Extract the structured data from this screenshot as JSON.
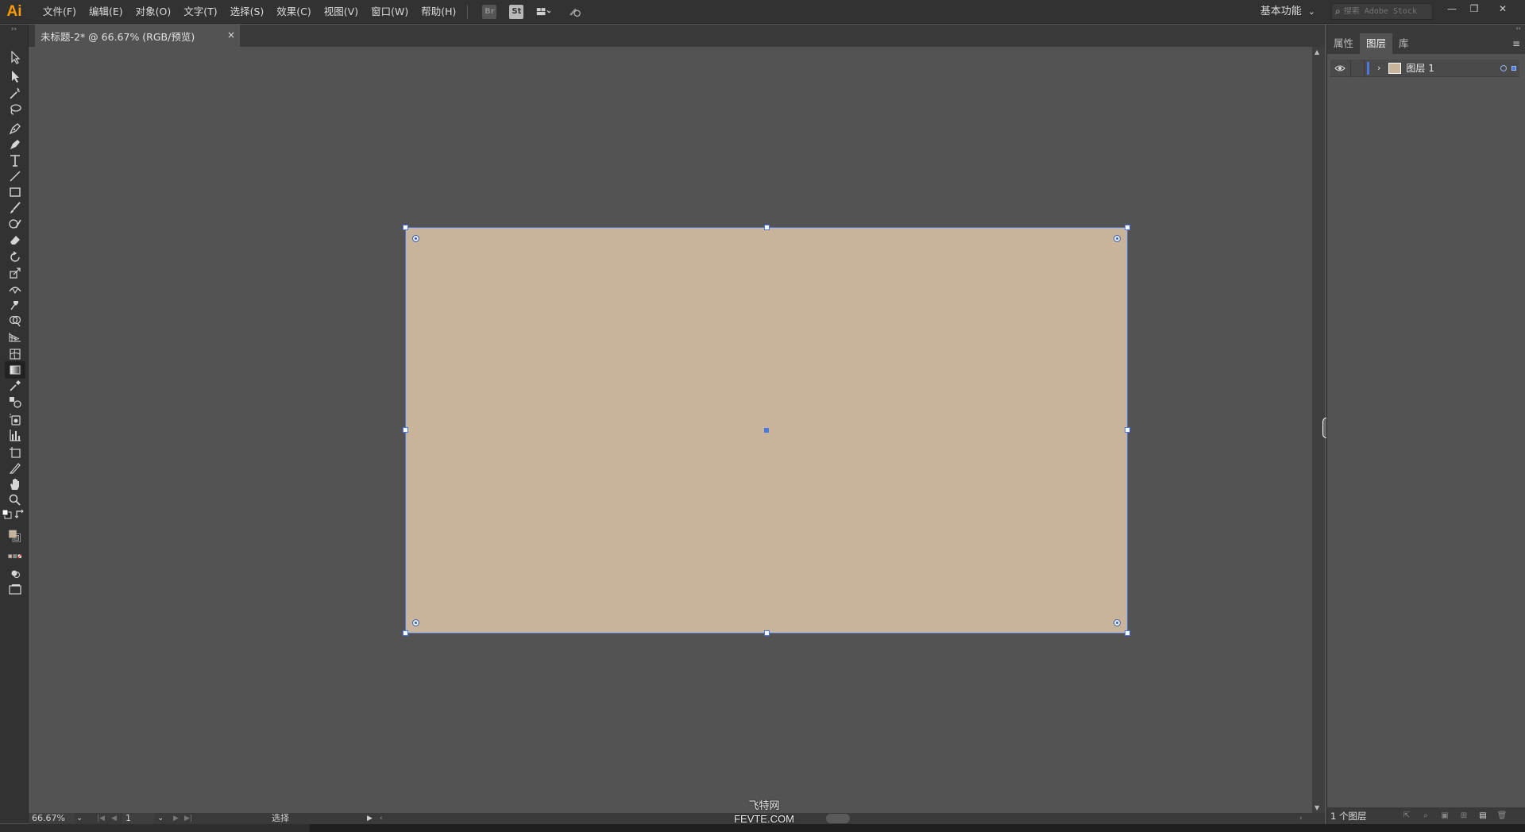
{
  "app": {
    "logo": "Ai",
    "menu": [
      "文件(F)",
      "编辑(E)",
      "对象(O)",
      "文字(T)",
      "选择(S)",
      "效果(C)",
      "视图(V)",
      "窗口(W)",
      "帮助(H)"
    ],
    "bridge_label": "Br",
    "stock_label": "St",
    "workspace": "基本功能",
    "stock_search_placeholder": "搜索 Adobe Stock"
  },
  "document": {
    "tab_title": "未标题-2* @ 66.67% (RGB/预览)",
    "tab_close": "×",
    "artboard_fill": "#c8b39b",
    "selection_color": "#4a78e0"
  },
  "status": {
    "zoom": "66.67%",
    "artboard_number": "1",
    "current_tool": "选择"
  },
  "panel": {
    "tabs": [
      "属性",
      "图层",
      "库"
    ],
    "active_tab": "图层",
    "layers": [
      {
        "name": "图层 1",
        "color": "#4a78e0",
        "visible": true
      }
    ],
    "footer_count": "1 个图层"
  },
  "watermark": {
    "line1": "飞特网",
    "line2": "FEVTE.COM"
  },
  "icons": {
    "tools": [
      "selection-tool",
      "direct-selection-tool",
      "magic-wand-tool",
      "lasso-tool",
      "pen-tool",
      "curvature-tool",
      "type-tool",
      "line-tool",
      "rectangle-tool",
      "paintbrush-tool",
      "shaper-tool",
      "eraser-tool",
      "rotate-tool",
      "scale-tool",
      "width-tool",
      "puppet-warp-tool",
      "shape-builder-tool",
      "perspective-grid-tool",
      "mesh-tool",
      "gradient-tool",
      "eyedropper-tool",
      "blend-tool",
      "symbol-sprayer-tool",
      "column-graph-tool",
      "artboard-tool",
      "slice-tool",
      "hand-tool",
      "zoom-tool"
    ]
  }
}
